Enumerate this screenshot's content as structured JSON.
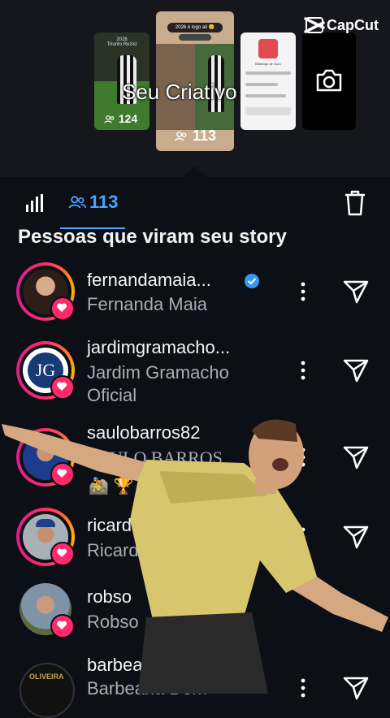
{
  "header": {
    "brand": "CapCut",
    "overlay_title": "Seu Criativo",
    "thumbs": [
      {
        "title": "2026\nTriunfo Rezist",
        "count": "124"
      },
      {
        "pill": "2026 é logo ali 😊",
        "count": "113"
      },
      {
        "logo_caption": "Botafogo de Ouro"
      },
      {
        "icon": "camera-icon"
      }
    ]
  },
  "tabs": {
    "stats_icon": "bar-chart-icon",
    "viewers_icon": "people-icon",
    "viewers_count": "113",
    "delete_icon": "trash-icon",
    "accent": "#4aa3ff"
  },
  "section_title": "Pessoas que viram seu story",
  "viewers": [
    {
      "username": "fernandamaia...",
      "fullname": "Fernanda Maia",
      "verified": true
    },
    {
      "username": "jardimgramacho...",
      "fullname": "Jardim Gramacho Oficial"
    },
    {
      "username": "saulobarros82",
      "fullname": "SAULO BARROS",
      "emojis": "🚵 🏆 🪙 🔸"
    },
    {
      "username": "ricardo_o",
      "fullname": "Ricardo"
    },
    {
      "username": "robso",
      "fullname": "Robso"
    },
    {
      "username": "barbeariadomoli...",
      "fullname": "Barbearia Dom"
    }
  ],
  "colors": {
    "heart": "#ff2a6a",
    "background": "#0c0f16"
  }
}
